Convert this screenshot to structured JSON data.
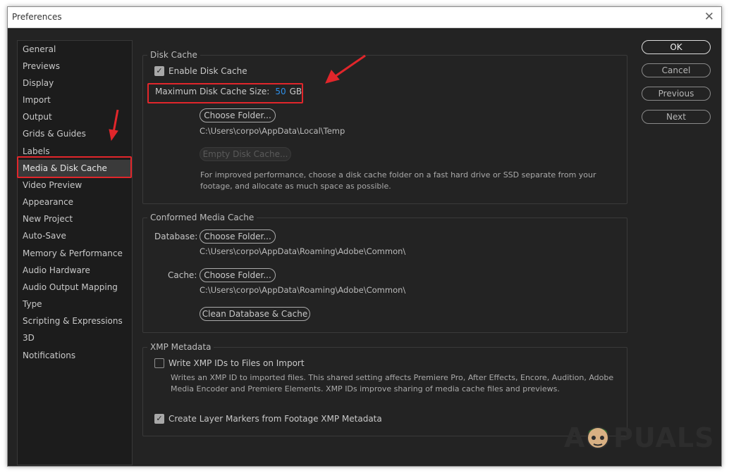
{
  "window": {
    "title": "Preferences",
    "close_glyph": "✕"
  },
  "sidebar": {
    "items": [
      {
        "label": "General"
      },
      {
        "label": "Previews"
      },
      {
        "label": "Display"
      },
      {
        "label": "Import"
      },
      {
        "label": "Output"
      },
      {
        "label": "Grids & Guides"
      },
      {
        "label": "Labels"
      },
      {
        "label": "Media & Disk Cache",
        "selected": true
      },
      {
        "label": "Video Preview"
      },
      {
        "label": "Appearance"
      },
      {
        "label": "New Project"
      },
      {
        "label": "Auto-Save"
      },
      {
        "label": "Memory & Performance"
      },
      {
        "label": "Audio Hardware"
      },
      {
        "label": "Audio Output Mapping"
      },
      {
        "label": "Type"
      },
      {
        "label": "Scripting & Expressions"
      },
      {
        "label": "3D"
      },
      {
        "label": "Notifications"
      }
    ]
  },
  "disk_cache": {
    "title": "Disk Cache",
    "enable_label": "Enable Disk Cache",
    "enable_checked": true,
    "max_size_label": "Maximum Disk Cache Size:",
    "max_size_value": "50",
    "max_size_unit": "GB",
    "choose_folder": "Choose Folder...",
    "folder_path": "C:\\Users\\corpo\\AppData\\Local\\Temp",
    "empty_cache": "Empty Disk Cache...",
    "description": "For improved performance, choose a disk cache folder on a fast hard drive or SSD separate from your footage, and allocate as much space as possible."
  },
  "conformed": {
    "title": "Conformed Media Cache",
    "database_label": "Database:",
    "database_button": "Choose Folder...",
    "database_path": "C:\\Users\\corpo\\AppData\\Roaming\\Adobe\\Common\\",
    "cache_label": "Cache:",
    "cache_button": "Choose Folder...",
    "cache_path": "C:\\Users\\corpo\\AppData\\Roaming\\Adobe\\Common\\",
    "clean_button": "Clean Database & Cache"
  },
  "xmp": {
    "title": "XMP Metadata",
    "write_label": "Write XMP IDs to Files on Import",
    "write_checked": false,
    "write_description": "Writes an XMP ID to imported files. This shared setting affects Premiere Pro, After Effects, Encore, Audition, Adobe Media Encoder and Premiere Elements. XMP IDs improve sharing of media cache files and previews.",
    "markers_label": "Create Layer Markers from Footage XMP Metadata",
    "markers_checked": true
  },
  "buttons": {
    "ok": "OK",
    "cancel": "Cancel",
    "previous": "Previous",
    "next": "Next"
  },
  "annotation": {
    "color": "#e1262b"
  },
  "watermark": {
    "text_left": "A",
    "text_right": "PUALS"
  }
}
